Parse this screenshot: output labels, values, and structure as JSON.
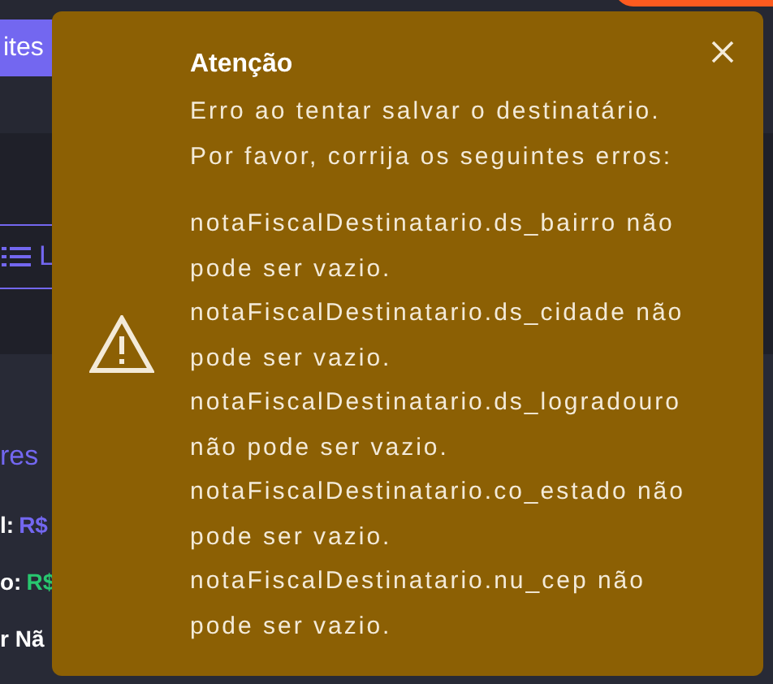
{
  "header": {
    "button_label": "ites"
  },
  "toolbar": {
    "list_button_label": "L"
  },
  "summary": {
    "heading": "res",
    "rows": [
      {
        "label": "l:",
        "value": "R$",
        "color": "#7367f0"
      },
      {
        "label": "o:",
        "value": "R$",
        "color": "#28c76f"
      },
      {
        "label": "r Nã"
      }
    ]
  },
  "alert": {
    "title": "Atenção",
    "message": [
      "Erro ao tentar salvar o destinatário.",
      "Por favor, corrija os seguintes erros:"
    ],
    "errors": [
      "notaFiscalDestinatario.ds_bairro não pode ser vazio.",
      "notaFiscalDestinatario.ds_cidade não pode ser vazio.",
      "notaFiscalDestinatario.ds_logradouro não pode ser vazio.",
      "notaFiscalDestinatario.co_estado não pode ser vazio.",
      "notaFiscalDestinatario.nu_cep não pode ser vazio."
    ]
  }
}
